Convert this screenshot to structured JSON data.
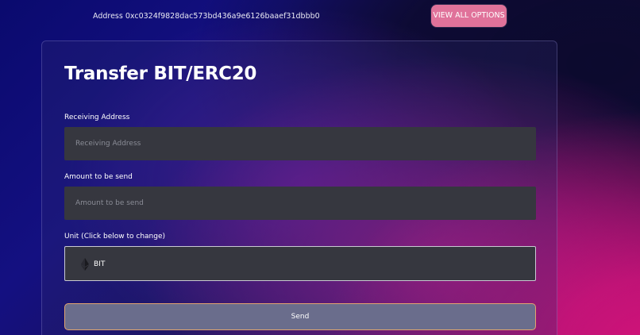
{
  "header": {
    "address_text": "Address 0xc0324f9828dac573bd436a9e6126baaef31dbbb0",
    "view_all_label": "VIEW ALL OPTIONS"
  },
  "form": {
    "title": "Transfer BIT/ERC20",
    "receiving_address": {
      "label": "Receiving Address",
      "placeholder": "Receiving Address",
      "value": ""
    },
    "amount": {
      "label": "Amount to be send",
      "placeholder": "Amount to be send",
      "value": ""
    },
    "unit": {
      "label": "Unit (Click below to change)",
      "selected": "BIT",
      "icon": "ethereum-icon"
    },
    "send_label": "Send"
  },
  "colors": {
    "view_all_button": "#e0729a",
    "input_background": "#36373f",
    "send_button": "#6a6d8c",
    "send_border": "#e2a46f"
  }
}
